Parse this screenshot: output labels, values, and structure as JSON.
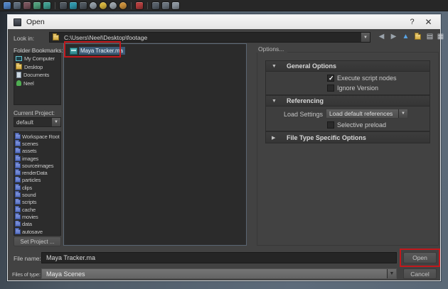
{
  "statusline": {
    "icons": [
      {
        "name": "statusline-icon-1",
        "type": "square",
        "color": "#4f81c2"
      },
      {
        "name": "statusline-icon-2",
        "type": "square",
        "color": "#5d6b79"
      },
      {
        "name": "statusline-icon-3",
        "type": "square",
        "color": "#77525a"
      },
      {
        "name": "statusline-icon-4",
        "type": "square",
        "color": "#4f9d7a"
      },
      {
        "name": "statusline-icon-5",
        "type": "square",
        "color": "#3f9d8f"
      },
      {
        "type": "sep"
      },
      {
        "name": "statusline-icon-6",
        "type": "square",
        "color": "#4e565e"
      },
      {
        "name": "statusline-icon-7",
        "type": "square",
        "color": "#2f96aa"
      },
      {
        "name": "statusline-icon-8",
        "type": "square",
        "color": "#4e565e"
      },
      {
        "name": "statusline-icon-9",
        "type": "circle",
        "color": "#8e98a2"
      },
      {
        "name": "statusline-icon-10",
        "type": "circle",
        "color": "#d4b23c"
      },
      {
        "name": "statusline-icon-11",
        "type": "circle",
        "color": "#97a0a8"
      },
      {
        "name": "statusline-icon-12",
        "type": "circle",
        "color": "#c98f3a"
      },
      {
        "type": "sep"
      },
      {
        "name": "statusline-icon-13",
        "type": "square",
        "color": "#b23d3d"
      },
      {
        "type": "sep"
      },
      {
        "name": "statusline-icon-14",
        "type": "square",
        "color": "#57606a"
      },
      {
        "name": "statusline-icon-15",
        "type": "square",
        "color": "#6a737d"
      },
      {
        "name": "statusline-icon-16",
        "type": "square",
        "color": "#8a939c"
      }
    ]
  },
  "dialog": {
    "title": "Open",
    "help_label": "?",
    "close_label": "✕",
    "look_in": {
      "label": "Look in:",
      "path": "C:\\Users\\Neel\\Desktop\\footage"
    },
    "bookmarks": {
      "label": "Folder Bookmarks:",
      "items": [
        {
          "label": "My Computer",
          "icon": "computer",
          "name": "bookmark-my-computer"
        },
        {
          "label": "Desktop",
          "icon": "folder-y",
          "name": "bookmark-desktop"
        },
        {
          "label": "Documents",
          "icon": "document",
          "name": "bookmark-documents"
        },
        {
          "label": "Neel",
          "icon": "user",
          "name": "bookmark-neel"
        }
      ]
    },
    "current_project": {
      "label": "Current Project:",
      "value": "default"
    },
    "project_folders": [
      "Workspace Root",
      "scenes",
      "assets",
      "images",
      "sourceimages",
      "renderData",
      "particles",
      "clips",
      "sound",
      "scripts",
      "cache",
      "movies",
      "data",
      "autosave"
    ],
    "set_project_label": "Set Project ...",
    "file_list": {
      "selected_file": "Maya Tracker.ma"
    },
    "options": {
      "label": "Options...",
      "sections": [
        {
          "title": "General Options",
          "checkboxes": [
            {
              "label": "Execute script nodes",
              "checked": true
            },
            {
              "label": "Ignore Version",
              "checked": false
            }
          ]
        },
        {
          "title": "Referencing",
          "load_settings": {
            "label": "Load Settings",
            "value": "Load default references"
          },
          "checkboxes": [
            {
              "label": "Selective preload",
              "checked": false
            }
          ]
        },
        {
          "title": "File Type Specific Options"
        }
      ]
    },
    "file_name": {
      "label": "File name:",
      "value": "Maya Tracker.ma"
    },
    "files_of_type": {
      "label": "Files of type:",
      "value": "Maya Scenes"
    },
    "open_label": "Open",
    "cancel_label": "Cancel"
  },
  "annotation_color": "#c2181c"
}
